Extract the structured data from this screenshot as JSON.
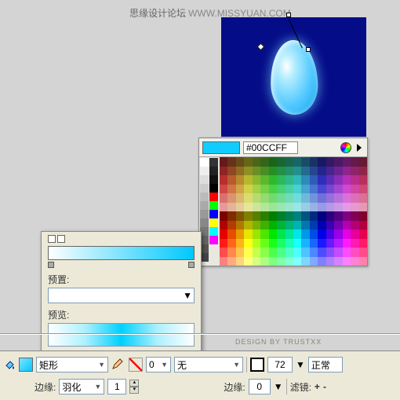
{
  "watermark": {
    "cn": "思缘设计论坛",
    "en": "WWW.MISSYUAN.COM"
  },
  "credit": "DESIGN BY TRUSTXX",
  "colorpanel": {
    "hex": "#00CCFF",
    "swatch_color": "#11ccff"
  },
  "gradpanel": {
    "preset_label": "预置:",
    "preview_label": "预览:"
  },
  "toolbar": {
    "shape": "矩形",
    "edge_label": "边缘:",
    "edge_mode": "羽化",
    "edge_value": "1",
    "fill": "无",
    "opacity": "0",
    "edge2_value": "0",
    "stroke_width": "72",
    "blend": "正常",
    "filter_label": "滤镜:",
    "plus": "+",
    "minus": "-"
  }
}
